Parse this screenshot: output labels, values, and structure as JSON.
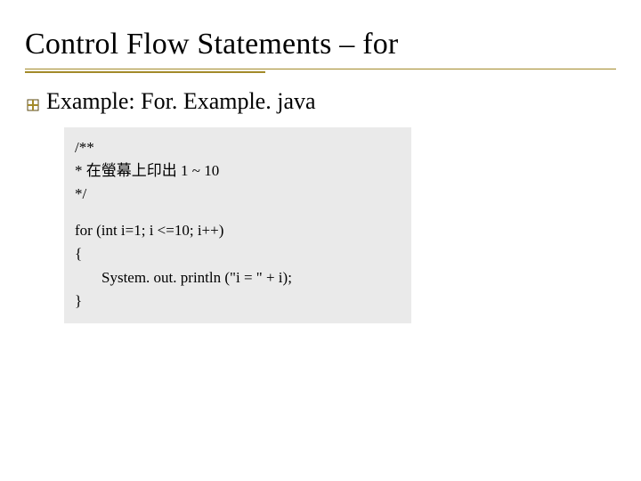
{
  "title": "Control Flow Statements – for",
  "bullet": {
    "label": "Example: For. Example. java"
  },
  "code": {
    "line1": "/**",
    "line2": " *  在螢幕上印出 1 ~ 10",
    "line3": " */",
    "line4": "for (int i=1; i <=10; i++)",
    "line5": "{",
    "line6": "System. out. println (\"i = \" + i);",
    "line7": "}"
  }
}
